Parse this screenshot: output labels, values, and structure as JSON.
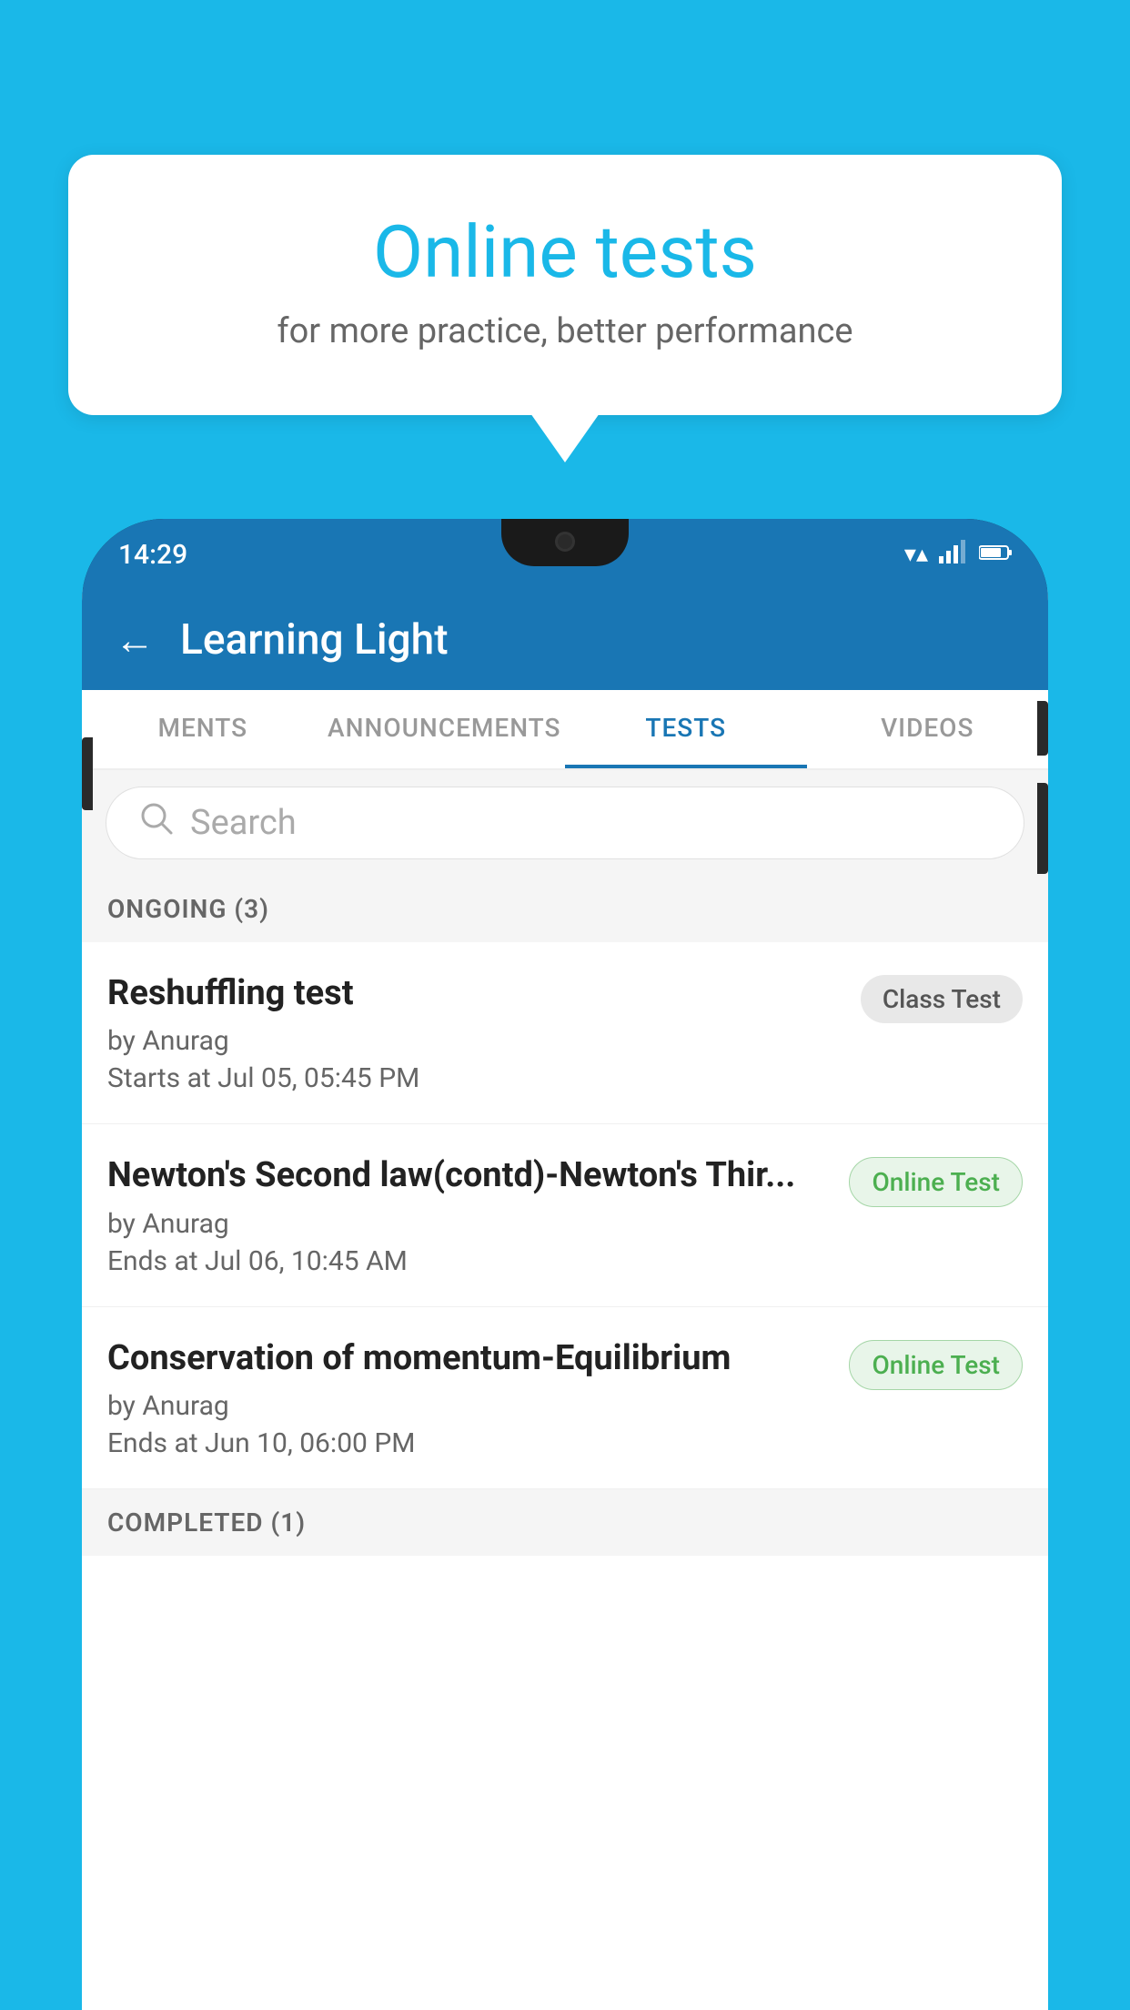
{
  "background_color": "#1ab8e8",
  "speech_bubble": {
    "title": "Online tests",
    "subtitle": "for more practice, better performance"
  },
  "phone": {
    "status_bar": {
      "time": "14:29",
      "icons": [
        "wifi",
        "signal",
        "battery"
      ]
    },
    "app_bar": {
      "title": "Learning Light",
      "back_label": "←"
    },
    "tabs": [
      {
        "label": "MENTS",
        "active": false
      },
      {
        "label": "ANNOUNCEMENTS",
        "active": false
      },
      {
        "label": "TESTS",
        "active": true
      },
      {
        "label": "VIDEOS",
        "active": false
      }
    ],
    "search": {
      "placeholder": "Search"
    },
    "ongoing_section": {
      "label": "ONGOING (3)"
    },
    "tests": [
      {
        "title": "Reshuffling test",
        "author": "by Anurag",
        "date": "Starts at  Jul 05, 05:45 PM",
        "badge": "Class Test",
        "badge_type": "class"
      },
      {
        "title": "Newton's Second law(contd)-Newton's Thir...",
        "author": "by Anurag",
        "date": "Ends at  Jul 06, 10:45 AM",
        "badge": "Online Test",
        "badge_type": "online"
      },
      {
        "title": "Conservation of momentum-Equilibrium",
        "author": "by Anurag",
        "date": "Ends at  Jun 10, 06:00 PM",
        "badge": "Online Test",
        "badge_type": "online"
      }
    ],
    "completed_section": {
      "label": "COMPLETED (1)"
    }
  }
}
